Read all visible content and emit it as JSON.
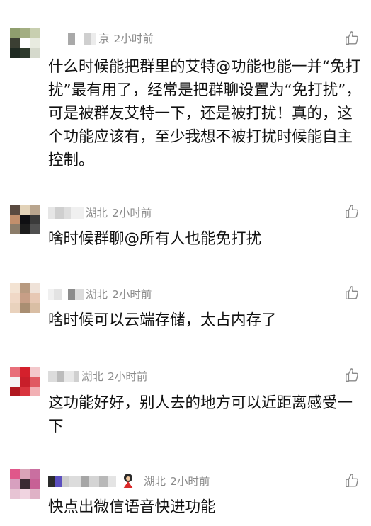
{
  "comments": [
    {
      "location": "京",
      "time": "2小时前",
      "text": "什么时候能把群里的艾特@功能也能一并“免打扰”最有用了，经常是把群聊设置为“免打扰”，可是被群友艾特一下，还是被打扰！真的，这个功能应该有，至少我想不被打扰时候能自主控制。",
      "like_icon": "thumbs-up-icon"
    },
    {
      "location": "湖北",
      "time": "2小时前",
      "text": "啥时候群聊@所有人也能免打扰",
      "like_icon": "thumbs-up-icon"
    },
    {
      "location": "湖北",
      "time": "2小时前",
      "text": "啥时候可以云端存储，太占内存了",
      "like_icon": "thumbs-up-icon"
    },
    {
      "location": "湖北",
      "time": "2小时前",
      "text": "这功能好好，别人去的地方可以近距离感受一下",
      "like_icon": "thumbs-up-icon"
    },
    {
      "location": "湖北",
      "time": "2小时前",
      "text": "快点出微信语音快进功能",
      "like_icon": "thumbs-up-icon"
    }
  ],
  "colors": {
    "meta_text": "#8a8a8a",
    "comment_text": "#111111",
    "icon": "#8a8a8a"
  }
}
